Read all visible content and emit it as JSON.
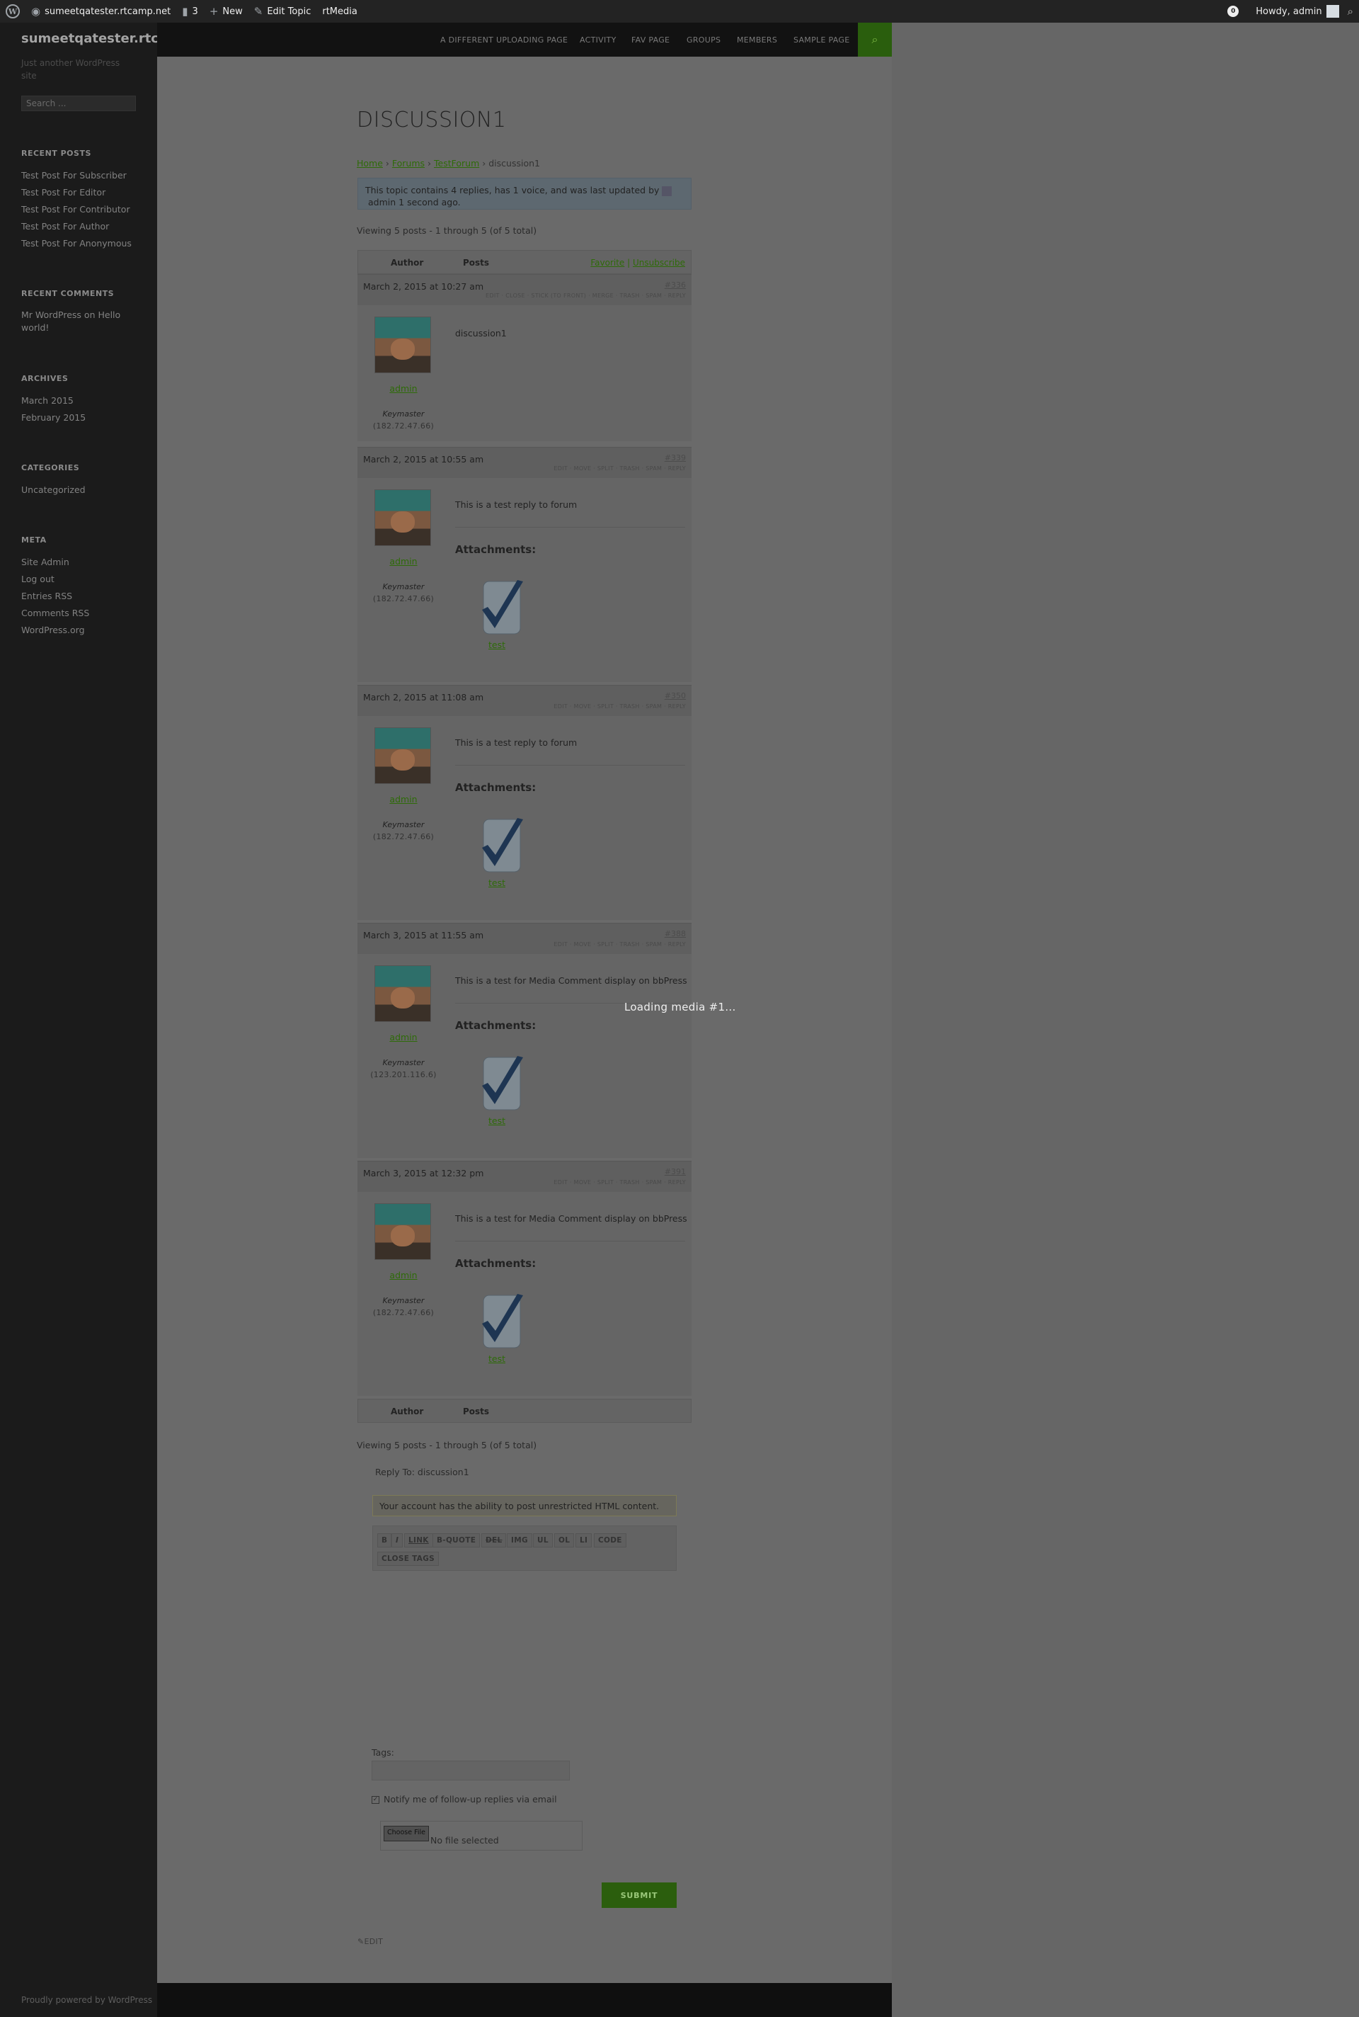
{
  "adminbar": {
    "site": "sumeetqatester.rtcamp.net",
    "comments_count": "3",
    "new_label": "New",
    "edit_topic_label": "Edit Topic",
    "rtmedia_label": "rtMedia",
    "notification_count": "0",
    "howdy": "Howdy, admin"
  },
  "sidebar": {
    "site_title": "sumeetqatester.rtcamp.net",
    "site_desc": "Just another WordPress site",
    "search_placeholder": "Search ...",
    "recent_posts_title": "RECENT POSTS",
    "recent_posts": [
      "Test Post For Subscriber",
      "Test Post For Editor",
      "Test Post For Contributor",
      "Test Post For Author",
      "Test Post For Anonymous"
    ],
    "recent_comments_title": "RECENT COMMENTS",
    "recent_comment_author": "Mr WordPress",
    "recent_comment_on": "on",
    "recent_comment_post": "Hello world!",
    "archives_title": "ARCHIVES",
    "archives": [
      "March 2015",
      "February 2015"
    ],
    "categories_title": "CATEGORIES",
    "categories": [
      "Uncategorized"
    ],
    "meta_title": "META",
    "meta": [
      "Site Admin",
      "Log out",
      "Entries RSS",
      "Comments RSS",
      "WordPress.org"
    ]
  },
  "nav": {
    "items": [
      "A DIFFERENT UPLOADING PAGE",
      "ACTIVITY",
      "FAV PAGE",
      "GROUPS",
      "MEMBERS",
      "SAMPLE PAGE"
    ]
  },
  "topic": {
    "title": "DISCUSSION1",
    "breadcrumb": [
      "Home",
      "Forums",
      "TestForum",
      "discussion1"
    ],
    "breadcrumb_sep": "›",
    "notice_line1": "This topic contains 4 replies, has 1 voice, and was last updated by",
    "notice_line2": "admin 1 second ago.",
    "viewing": "Viewing 5 posts - 1 through 5 (of 5 total)",
    "head_author": "Author",
    "head_posts": "Posts",
    "favorite": "Favorite",
    "fav_sep": "|",
    "unsubscribe": "Unsubscribe",
    "attachments_label": "Attachments:",
    "role": "Keymaster",
    "author": "admin"
  },
  "replies": [
    {
      "date": "March 2, 2015 at 10:27 am",
      "num": "#336",
      "actions": "EDIT · CLOSE · STICK (TO FRONT) · MERGE · TRASH · SPAM · REPLY",
      "ip": "(182.72.47.66)",
      "text": "discussion1",
      "has_attachment": false
    },
    {
      "date": "March 2, 2015 at 10:55 am",
      "num": "#339",
      "actions": "EDIT · MOVE · SPLIT · TRASH · SPAM · REPLY",
      "ip": "(182.72.47.66)",
      "text": "This is a test reply to forum",
      "attachment": "test",
      "has_attachment": true
    },
    {
      "date": "March 2, 2015 at 11:08 am",
      "num": "#350",
      "actions": "EDIT · MOVE · SPLIT · TRASH · SPAM · REPLY",
      "ip": "(182.72.47.66)",
      "text": "This is a test reply to forum",
      "attachment": "test",
      "has_attachment": true
    },
    {
      "date": "March 3, 2015 at 11:55 am",
      "num": "#388",
      "actions": "EDIT · MOVE · SPLIT · TRASH · SPAM · REPLY",
      "ip": "(123.201.116.6)",
      "text": "This is a test for Media Comment display on bbPress",
      "attachment": "test",
      "has_attachment": true
    },
    {
      "date": "March 3, 2015 at 12:32 pm",
      "num": "#391",
      "actions": "EDIT · MOVE · SPLIT · TRASH · SPAM · REPLY",
      "ip": "(182.72.47.66)",
      "text": "This is a test for Media Comment display on bbPress",
      "attachment": "test",
      "has_attachment": true
    }
  ],
  "loading": "Loading media #1...",
  "form": {
    "reply_to": "Reply To: discussion1",
    "html_notice": "Your account has the ability to post unrestricted HTML content.",
    "quicktags": [
      "B",
      "I",
      "LINK",
      "B-QUOTE",
      "DEL",
      "IMG",
      "UL",
      "OL",
      "LI",
      "CODE",
      "CLOSE TAGS"
    ],
    "tags_label": "Tags:",
    "notify_label": "Notify me of follow-up replies via email",
    "file_button": "Choose File",
    "file_none": "No file selected",
    "submit": "SUBMIT",
    "edit": "EDIT"
  },
  "footer": "Proudly powered by WordPress",
  "colors": {
    "accent_green": "#2b5e0d",
    "link_green": "#2e6b08",
    "overlay_gray": "#6a6a6a",
    "dark_bg": "#1b1b1b"
  }
}
